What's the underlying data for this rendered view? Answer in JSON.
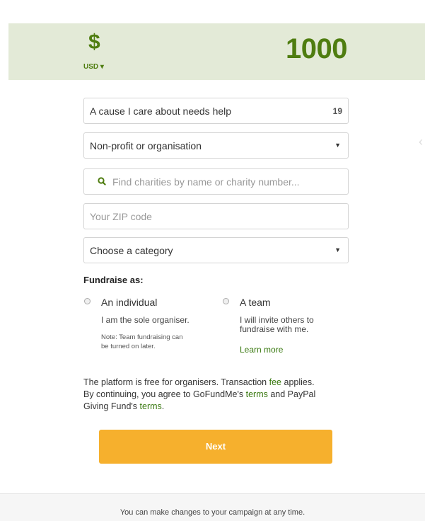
{
  "goal": {
    "currency_symbol": "$",
    "currency_code": "USD ▾",
    "amount": "1000"
  },
  "form": {
    "title_field": {
      "value": "A cause I care about needs help",
      "char_counter": "19"
    },
    "beneficiary_select": {
      "value": "Non-profit or organisation",
      "icon": "caret-down-icon"
    },
    "charity_search": {
      "placeholder": "Find charities by name or charity number...",
      "icon": "search-icon"
    },
    "zip_field": {
      "placeholder": "Your ZIP code"
    },
    "category_select": {
      "value": "Choose a category",
      "icon": "caret-down-icon"
    }
  },
  "fundraise_as": {
    "label": "Fundraise as:",
    "individual": {
      "title": "An individual",
      "description": "I am the sole organiser.",
      "note_line1": "Note: Team fundraising can",
      "note_line2": "be turned on later."
    },
    "team": {
      "title": "A team",
      "description_line1": "I will invite others to",
      "description_line2": "fundraise with me.",
      "learn_more": "Learn more"
    }
  },
  "legal": {
    "line1_pre": "The platform is free for organisers. Transaction ",
    "fee_link": "fee",
    "line1_post": " applies.",
    "line2_pre": "By continuing, you agree to GoFundMe's ",
    "terms_link": "terms",
    "line2_mid": " and PayPal",
    "line3_pre": "Giving Fund's ",
    "terms_link_2": "terms",
    "line3_post": "."
  },
  "next_button": {
    "label": "Next"
  },
  "footer": {
    "note": "You can make changes to your campaign at any time."
  },
  "colors": {
    "brand_green": "#4f7d10",
    "goal_bar_bg": "#e3ead7",
    "link_green": "#3b7a12",
    "button_orange": "#f6b02d"
  }
}
